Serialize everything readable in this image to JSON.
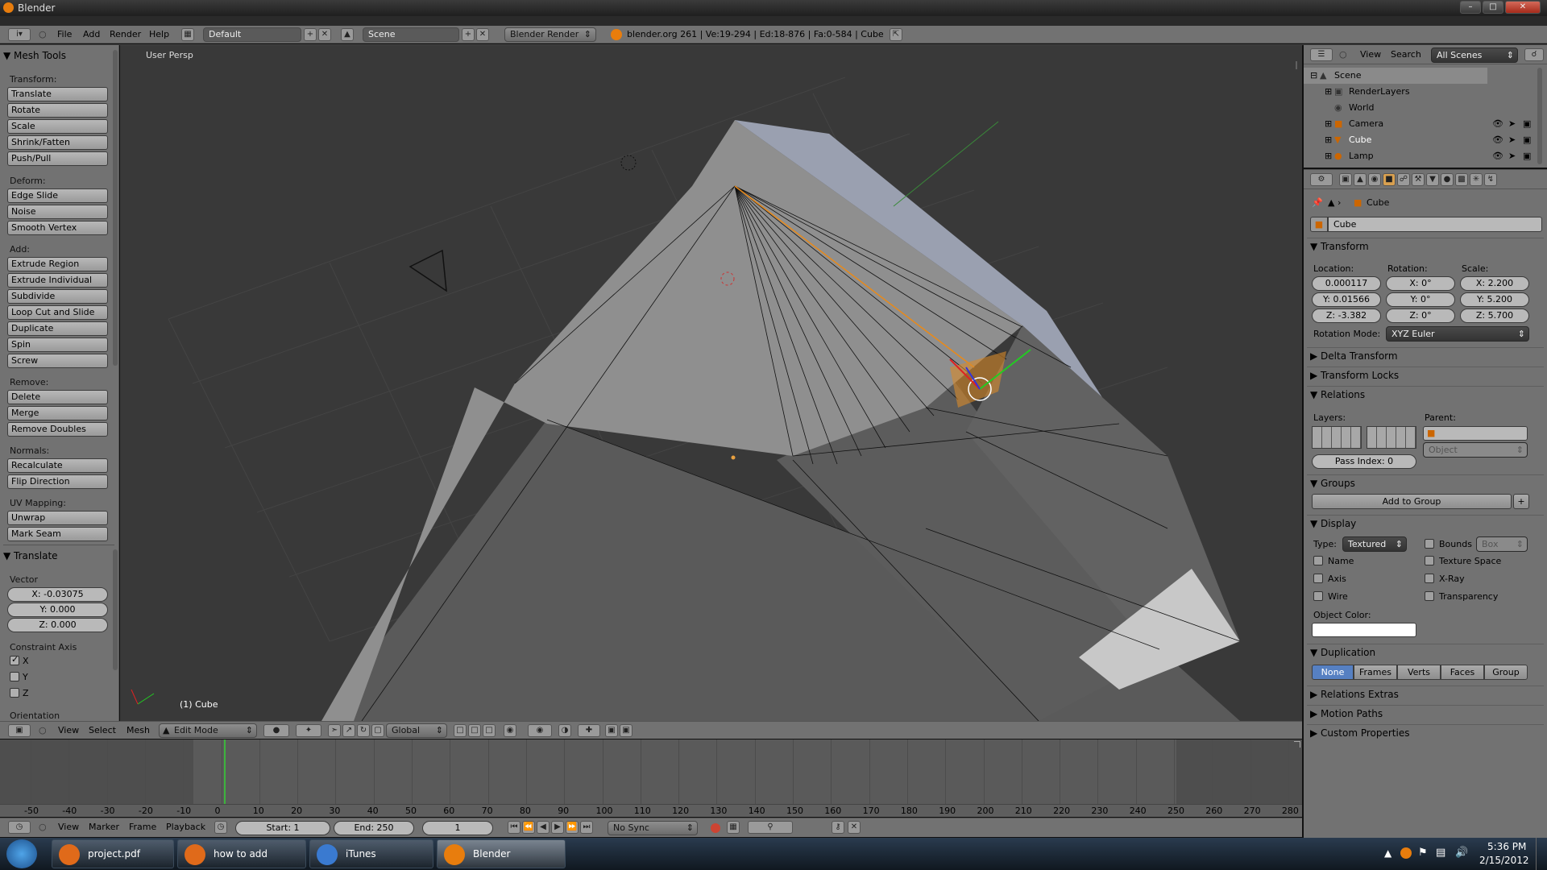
{
  "window": {
    "title": "Blender"
  },
  "info": {
    "menus": [
      "File",
      "Add",
      "Render",
      "Help"
    ],
    "layout": "Default",
    "scene": "Scene",
    "engine": "Blender Render",
    "stats": "blender.org 261 | Ve:19-294 | Ed:18-876 | Fa:0-584 | Cube"
  },
  "toolshelf": {
    "title": "Mesh Tools",
    "sections": [
      {
        "label": "Transform:",
        "buttons": [
          "Translate",
          "Rotate",
          "Scale",
          "Shrink/Fatten",
          "Push/Pull"
        ]
      },
      {
        "label": "Deform:",
        "buttons": [
          "Edge Slide",
          "Noise",
          "Smooth Vertex"
        ]
      },
      {
        "label": "Add:",
        "buttons": [
          "Extrude Region",
          "Extrude Individual",
          "Subdivide",
          "Loop Cut and Slide",
          "Duplicate",
          "Spin",
          "Screw"
        ]
      },
      {
        "label": "Remove:",
        "buttons": [
          "Delete",
          "Merge",
          "Remove Doubles"
        ]
      },
      {
        "label": "Normals:",
        "buttons": [
          "Recalculate",
          "Flip Direction"
        ]
      },
      {
        "label": "UV Mapping:",
        "buttons": [
          "Unwrap",
          "Mark Seam"
        ]
      }
    ],
    "operator": {
      "title": "Translate",
      "vector_label": "Vector",
      "x": "X: -0.03075",
      "y": "Y: 0.000",
      "z": "Z: 0.000",
      "constraint_label": "Constraint Axis",
      "axes": [
        {
          "label": "X",
          "checked": true
        },
        {
          "label": "Y",
          "checked": false
        },
        {
          "label": "Z",
          "checked": false
        }
      ],
      "orientation_label": "Orientation"
    }
  },
  "viewport": {
    "persp": "User Persp",
    "object": "(1) Cube"
  },
  "view3d_header": {
    "menus": [
      "View",
      "Select",
      "Mesh"
    ],
    "mode": "Edit Mode",
    "orientation": "Global"
  },
  "timeline": {
    "ticks": [
      "-50",
      "-40",
      "-30",
      "-20",
      "-10",
      "0",
      "10",
      "20",
      "30",
      "40",
      "50",
      "60",
      "70",
      "80",
      "90",
      "100",
      "110",
      "120",
      "130",
      "140",
      "150",
      "160",
      "170",
      "180",
      "190",
      "200",
      "210",
      "220",
      "230",
      "240",
      "250",
      "260",
      "270",
      "280"
    ],
    "menus": [
      "View",
      "Marker",
      "Frame",
      "Playback"
    ],
    "start": "Start: 1",
    "end": "End: 250",
    "current": "1",
    "sync": "No Sync"
  },
  "outliner": {
    "menus": [
      "View",
      "Search"
    ],
    "filter": "All Scenes",
    "items": [
      {
        "name": "Scene",
        "selected": true
      },
      {
        "name": "RenderLayers"
      },
      {
        "name": "World"
      },
      {
        "name": "Camera"
      },
      {
        "name": "Cube"
      },
      {
        "name": "Lamp"
      }
    ]
  },
  "properties": {
    "context": "Cube",
    "object_name": "Cube",
    "transform": {
      "title": "Transform",
      "location_label": "Location:",
      "rotation_label": "Rotation:",
      "scale_label": "Scale:",
      "loc": [
        "0.000117",
        "Y: 0.01566",
        "Z: -3.382"
      ],
      "rot": [
        "X: 0°",
        "Y: 0°",
        "Z: 0°"
      ],
      "scale": [
        "X: 2.200",
        "Y: 5.200",
        "Z: 5.700"
      ],
      "rotation_mode_label": "Rotation Mode:",
      "rotation_mode": "XYZ Euler"
    },
    "delta": "Delta Transform",
    "locks": "Transform Locks",
    "relations": {
      "title": "Relations",
      "layers_label": "Layers:",
      "parent_label": "Parent:",
      "parent_type": "Object",
      "pass_index": "Pass Index: 0"
    },
    "groups": {
      "title": "Groups",
      "add": "Add to Group"
    },
    "display": {
      "title": "Display",
      "type_label": "Type:",
      "type": "Textured",
      "bounds": "Bounds",
      "bounds_type": "Box",
      "name": "Name",
      "texture_space": "Texture Space",
      "axis": "Axis",
      "xray": "X-Ray",
      "wire": "Wire",
      "transparency": "Transparency",
      "object_color": "Object Color:"
    },
    "duplication": {
      "title": "Duplication",
      "options": [
        "None",
        "Frames",
        "Verts",
        "Faces",
        "Group"
      ]
    },
    "relations_extras": "Relations Extras",
    "motion_paths": "Motion Paths",
    "custom_properties": "Custom Properties"
  },
  "taskbar": {
    "tasks": [
      "project.pdf (appli...",
      "how to add vertic...",
      "iTunes",
      "Blender"
    ],
    "time": "5:36 PM",
    "date": "2/15/2012"
  }
}
